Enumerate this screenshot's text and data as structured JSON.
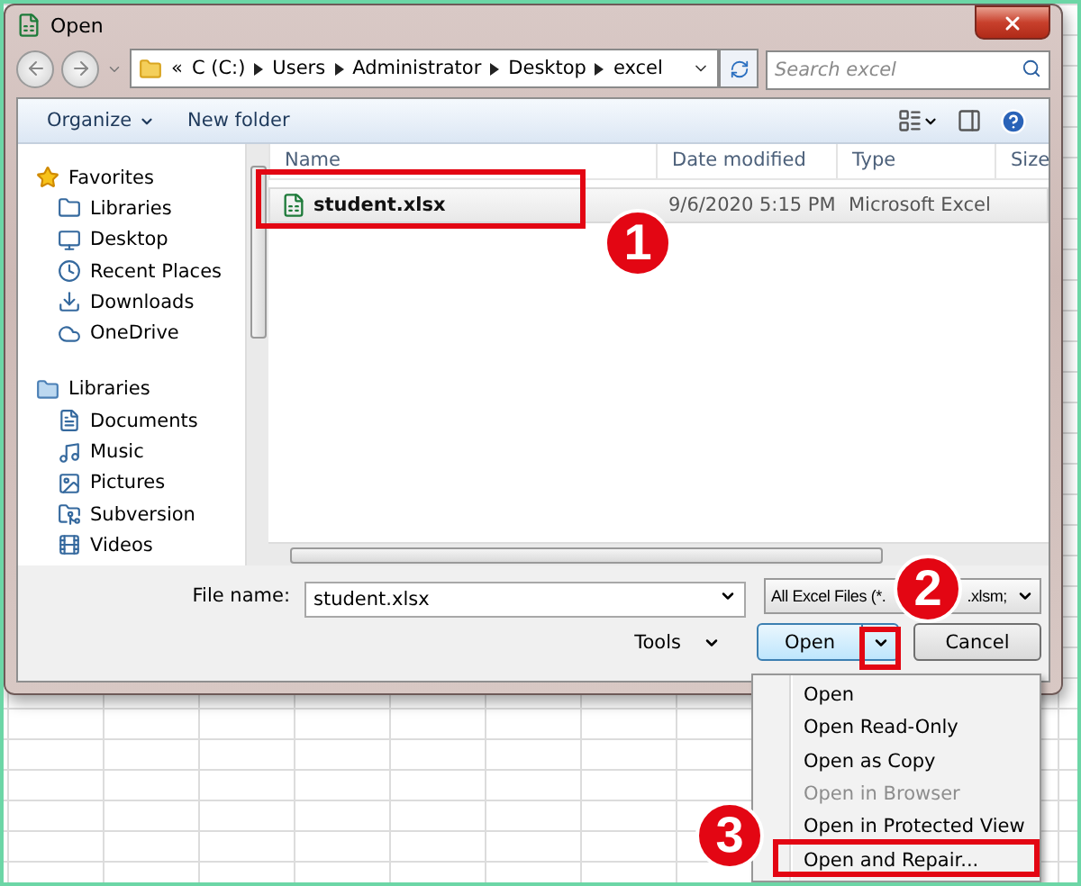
{
  "window": {
    "title": "Open"
  },
  "address": {
    "overflow": "«",
    "crumbs": [
      "C (C:)",
      "Users",
      "Administrator",
      "Desktop",
      "excel"
    ]
  },
  "search": {
    "placeholder": "Search excel"
  },
  "toolbar": {
    "buttons": [
      {
        "label": "Organize",
        "dropdown": true
      },
      {
        "label": "New folder",
        "dropdown": false
      }
    ]
  },
  "sidebar": {
    "groups": [
      {
        "label": "Favorites",
        "children": [
          {
            "label": "Libraries"
          },
          {
            "label": "Desktop"
          },
          {
            "label": "Recent Places"
          },
          {
            "label": "Downloads"
          },
          {
            "label": "OneDrive"
          }
        ]
      },
      {
        "label": "Libraries",
        "children": [
          {
            "label": "Documents"
          },
          {
            "label": "Music"
          },
          {
            "label": "Pictures"
          },
          {
            "label": "Subversion"
          },
          {
            "label": "Videos"
          }
        ]
      }
    ]
  },
  "table": {
    "columns": [
      "Name",
      "Date modified",
      "Type",
      "Size"
    ],
    "rows": [
      {
        "name": "student.xlsx",
        "date": "9/6/2020 5:15 PM",
        "type": "Microsoft Excel",
        "selected": true
      }
    ]
  },
  "file_name": {
    "label": "File name:",
    "value": "student.xlsx"
  },
  "filter": {
    "start": "All Excel Files (*.",
    "end": ".xlsm;"
  },
  "tools": {
    "label": "Tools"
  },
  "buttons": [
    {
      "label": "Open",
      "kind": "split"
    },
    {
      "label": "Cancel",
      "kind": "plain"
    }
  ],
  "menu": [
    {
      "label": "Open",
      "disabled": false
    },
    {
      "label": "Open Read-Only",
      "disabled": false
    },
    {
      "label": "Open as Copy",
      "disabled": false
    },
    {
      "label": "Open in Browser",
      "disabled": true
    },
    {
      "label": "Open in Protected View",
      "disabled": false
    },
    {
      "label": "Open and Repair...",
      "disabled": false
    }
  ],
  "annotations": [
    {
      "number": "1"
    },
    {
      "number": "2"
    },
    {
      "number": "3"
    }
  ]
}
